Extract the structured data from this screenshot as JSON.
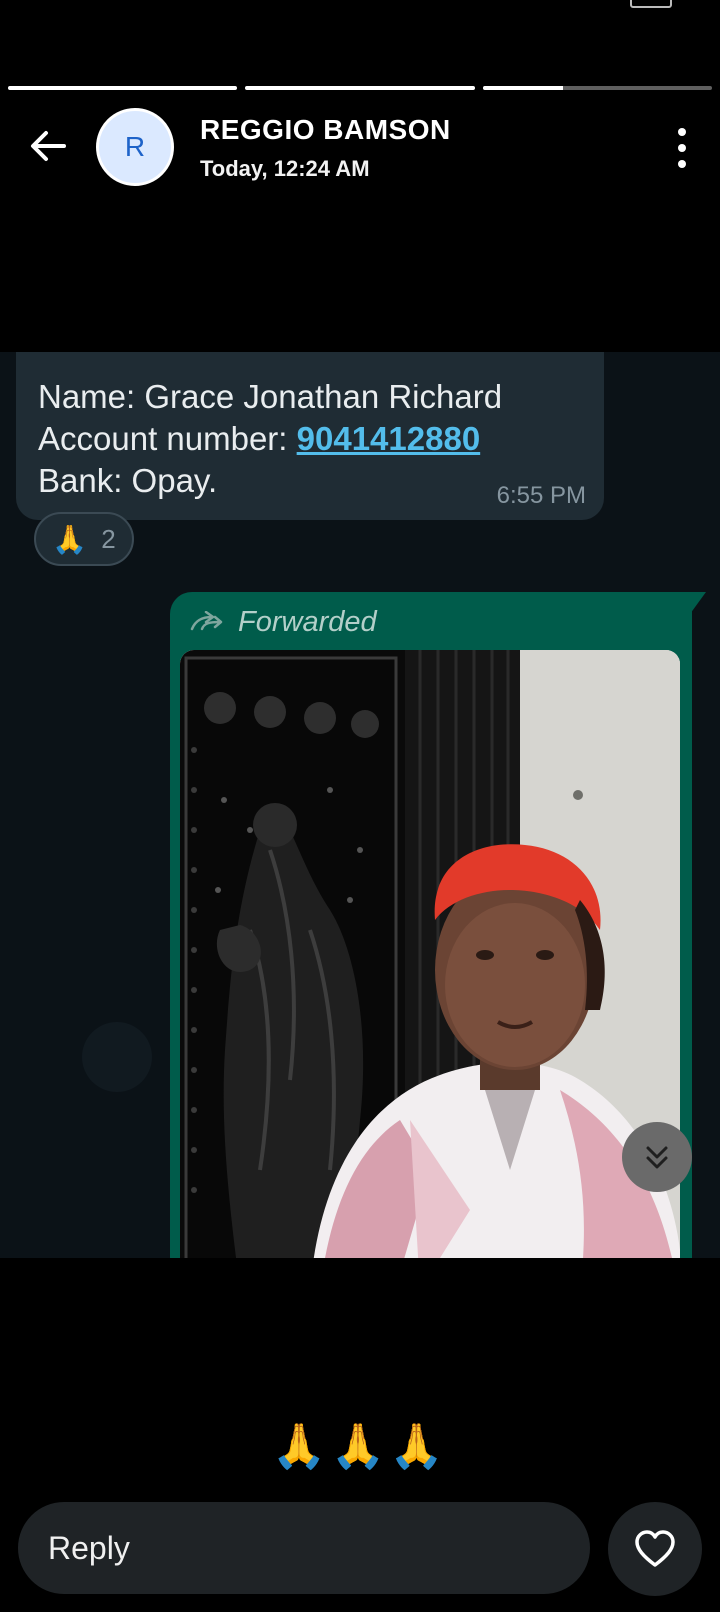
{
  "story": {
    "segments": [
      {
        "progress": 1.0
      },
      {
        "progress": 1.0
      },
      {
        "progress": 0.35
      }
    ]
  },
  "header": {
    "avatar_initial": "R",
    "contact_name": "REGGIO BAMSON",
    "timestamp": "Today, 12:24 AM"
  },
  "chat": {
    "incoming": {
      "name_line": "Name: Grace Jonathan Richard",
      "account_prefix": "Account number: ",
      "account_number": "9041412880",
      "bank_line": "Bank: Opay.",
      "time": "6:55 PM"
    },
    "reaction": {
      "emoji": "🙏",
      "count": "2"
    },
    "outgoing": {
      "forwarded_label": "Forwarded"
    }
  },
  "footer": {
    "caption": "🙏🙏🙏",
    "reply_placeholder": "Reply"
  },
  "colors": {
    "background": "#000000",
    "chat_bg": "#0b1217",
    "incoming_bubble": "#1f2c34",
    "outgoing_bubble": "#005c4b",
    "link": "#53bdeb",
    "avatar_bg": "#dbe9ff",
    "avatar_text": "#1e63c9"
  },
  "icons": {
    "back": "back-arrow-icon",
    "menu": "more-vertical-icon",
    "forward": "forward-arrow-icon",
    "scroll": "double-chevron-down-icon",
    "like": "heart-icon"
  }
}
